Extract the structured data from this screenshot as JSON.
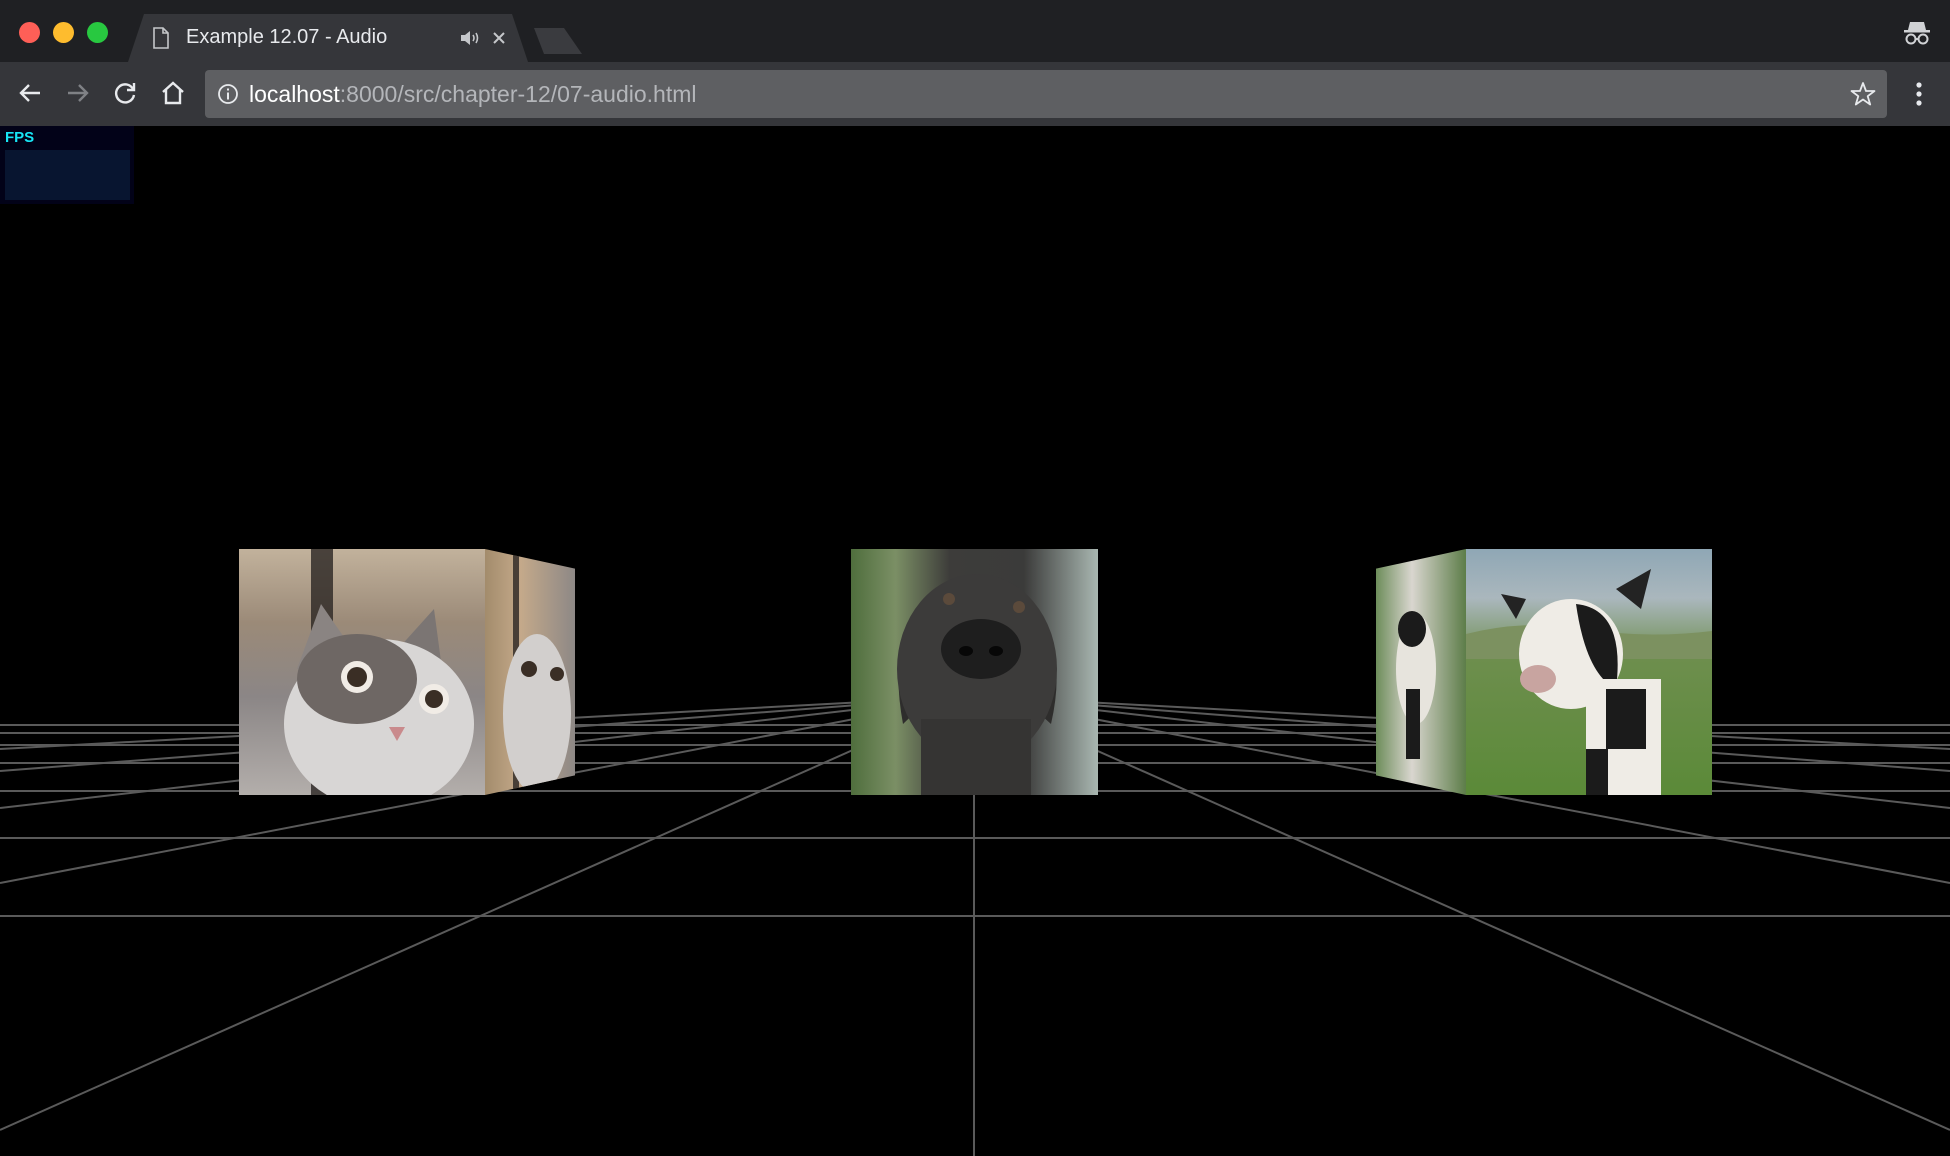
{
  "browser": {
    "tab": {
      "title": "Example 12.07 - Audio"
    },
    "address_bar": {
      "host": "localhost",
      "path": ":8000/src/chapter-12/07-audio.html"
    },
    "icons": {
      "back": "arrow-left-icon",
      "forward": "arrow-right-icon",
      "reload": "reload-icon",
      "home": "home-icon",
      "info": "info-icon",
      "bookmark": "star-icon",
      "menu": "kebab-menu-icon",
      "incognito": "incognito-icon",
      "audio": "speaker-icon"
    },
    "colors": {
      "tabstrip": "#1f2023",
      "toolbar": "#35363a",
      "omnibox": "#5e5f62"
    }
  },
  "page": {
    "stats": {
      "label": "FPS",
      "label_color": "#17e6f6"
    },
    "scene": {
      "cubes": [
        {
          "id": "cat",
          "texture": "cat"
        },
        {
          "id": "dog",
          "texture": "dog"
        },
        {
          "id": "cow",
          "texture": "cow"
        }
      ]
    }
  }
}
